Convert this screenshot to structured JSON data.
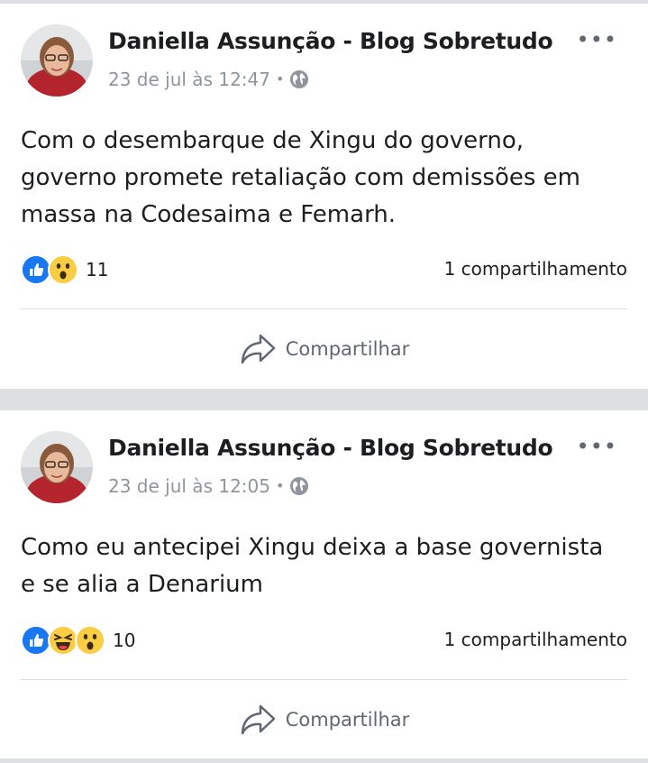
{
  "posts": [
    {
      "author": "Daniella Assunção - Blog Sobretudo",
      "timestamp": "23 de jul às 12:47",
      "separator": "•",
      "privacy_icon": "globe-icon",
      "more_label": "•••",
      "text": "Com o desembarque de Xingu do governo, governo promete retaliação com  demissões em massa na Codesaima e Femarh.",
      "reactions": [
        "like",
        "wow"
      ],
      "reaction_count": "11",
      "shares": "1 compartilhamento",
      "share_label": "Compartilhar"
    },
    {
      "author": "Daniella Assunção - Blog Sobretudo",
      "timestamp": "23 de jul às 12:05",
      "separator": "•",
      "privacy_icon": "globe-icon",
      "more_label": "•••",
      "text": "Como eu antecipei Xingu deixa a base governista e se alia a Denarium",
      "reactions": [
        "like",
        "haha",
        "wow"
      ],
      "reaction_count": "10",
      "shares": "1 compartilhamento",
      "share_label": "Compartilhar"
    }
  ],
  "colors": {
    "feed_background": "#dddfe2",
    "card_background": "#ffffff",
    "like_blue": "#1877f2",
    "emoji_yellow": "#fbcd43",
    "secondary_text": "#90949c",
    "action_text": "#606770"
  }
}
